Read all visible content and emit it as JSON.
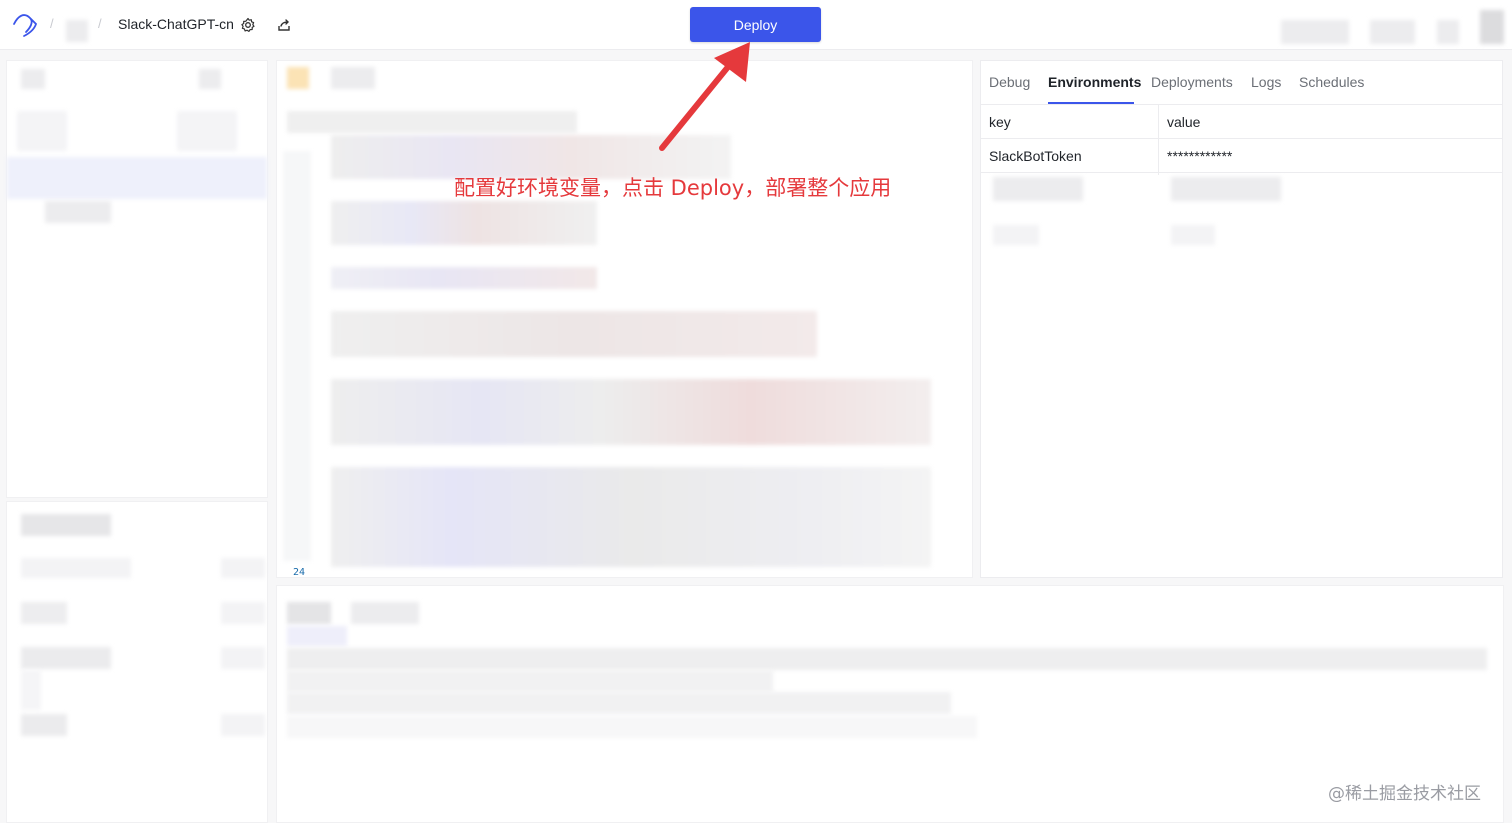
{
  "header": {
    "project_name": "Slack-ChatGPT-cn",
    "deploy_label": "Deploy",
    "breadcrumb_separator": "/"
  },
  "right_panel": {
    "tabs": [
      {
        "label": "Debug",
        "active": false
      },
      {
        "label": "Environments",
        "active": true
      },
      {
        "label": "Deployments",
        "active": false
      },
      {
        "label": "Logs",
        "active": false
      },
      {
        "label": "Schedules",
        "active": false
      }
    ],
    "env_table": {
      "headers": [
        "key",
        "value"
      ],
      "rows": [
        {
          "key": "SlackBotToken",
          "value": "************"
        }
      ]
    }
  },
  "editor": {
    "line_number": "24"
  },
  "annotation": {
    "text": "配置好环境变量，点击 Deploy，部署整个应用"
  },
  "watermark": "@稀土掘金技术社区",
  "colors": {
    "accent": "#3b55ea",
    "annotation": "#e5393c"
  },
  "icons": [
    "logo-icon",
    "settings-gear-icon",
    "share-icon"
  ]
}
